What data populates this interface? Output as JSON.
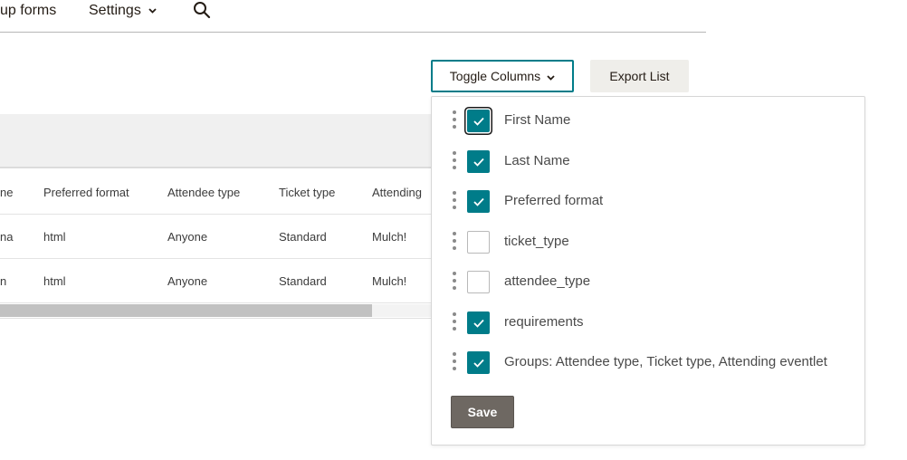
{
  "nav": {
    "forms_label": "up forms",
    "settings_label": "Settings",
    "settings_icon": "chevron-down-icon",
    "search_icon": "search-icon"
  },
  "actions": {
    "toggle_columns_label": "Toggle Columns",
    "toggle_columns_icon": "chevron-down-icon",
    "export_label": "Export List"
  },
  "table": {
    "headers": [
      "ne",
      "Preferred format",
      "Attendee type",
      "Ticket type",
      "Attending"
    ],
    "rows": [
      [
        "na",
        "html",
        "Anyone",
        "Standard",
        "Mulch!"
      ],
      [
        "n",
        "html",
        "Anyone",
        "Standard",
        "Mulch!"
      ]
    ]
  },
  "column_menu": {
    "options": [
      {
        "label": "First Name",
        "checked": true
      },
      {
        "label": "Last Name",
        "checked": true
      },
      {
        "label": "Preferred format",
        "checked": true
      },
      {
        "label": "ticket_type",
        "checked": false
      },
      {
        "label": "attendee_type",
        "checked": false
      },
      {
        "label": "requirements",
        "checked": true
      },
      {
        "label": "Groups: Attendee type, Ticket type, Attending eventlet",
        "checked": true
      }
    ],
    "save_label": "Save"
  },
  "colors": {
    "accent": "#007c89",
    "save_button": "#6e6862",
    "export_button_bg": "#efeeea"
  }
}
